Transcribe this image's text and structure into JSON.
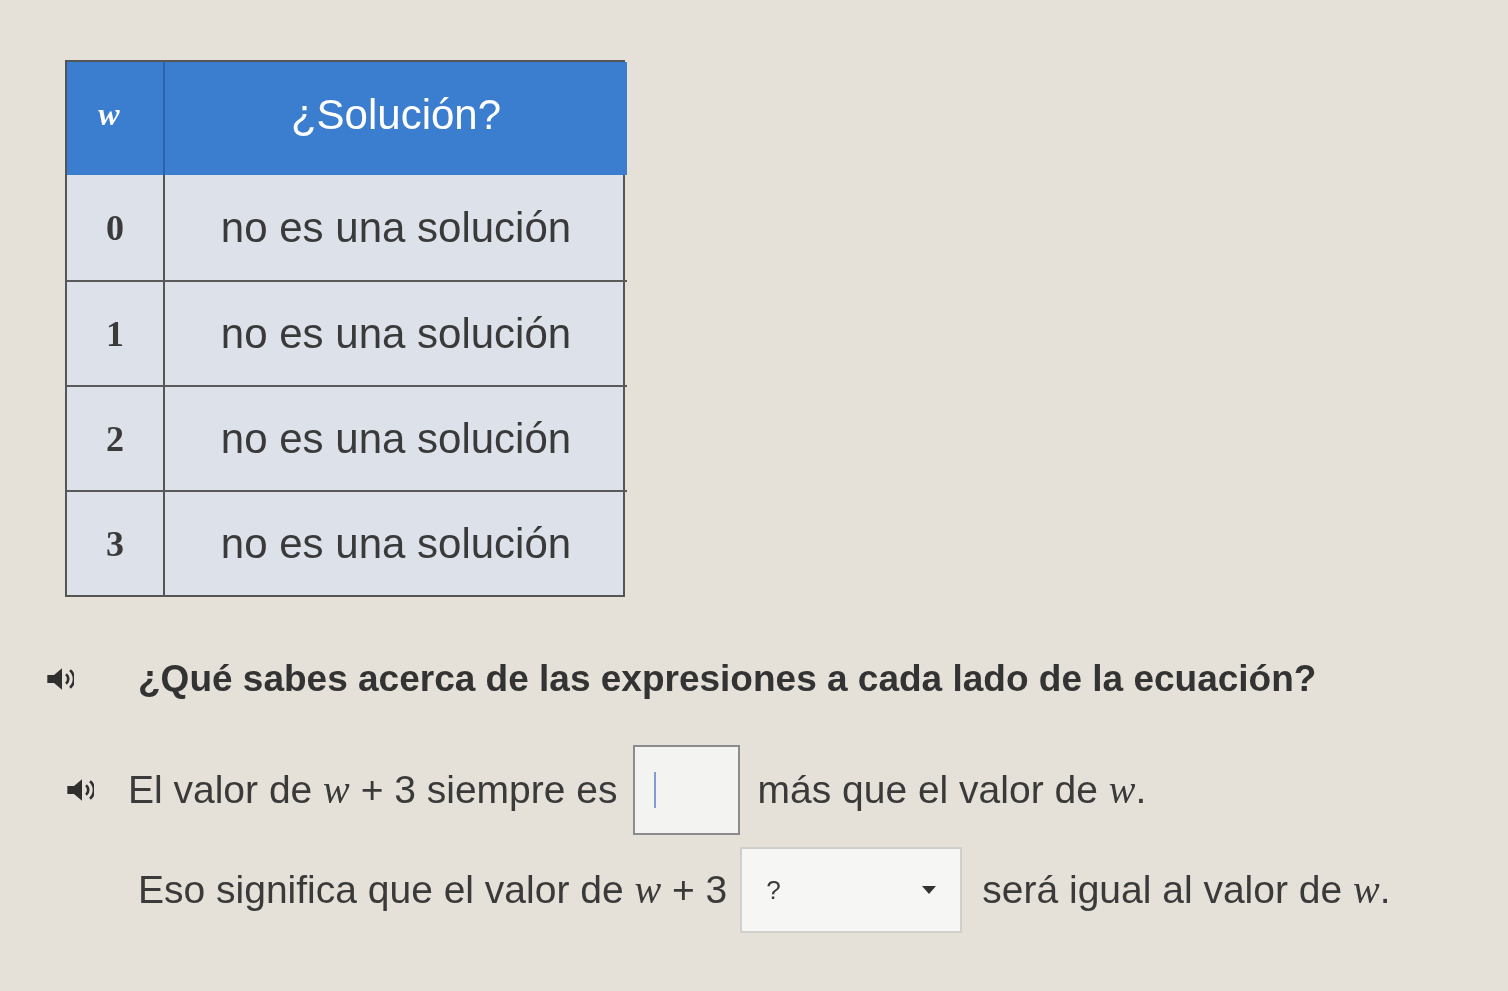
{
  "table": {
    "columns": [
      "w",
      "¿Solución?"
    ],
    "rows": [
      [
        "0",
        "no es una solución"
      ],
      [
        "1",
        "no es una solución"
      ],
      [
        "2",
        "no es una solución"
      ],
      [
        "3",
        "no es una solución"
      ]
    ]
  },
  "question": {
    "audio": true,
    "text": "¿Qué sabes acerca de las expresiones a cada lado de la ecuación?"
  },
  "sentences": [
    {
      "kind": "input",
      "audio": true,
      "before": "El valor de *w* + 3 siempre es",
      "field": {
        "focused": true
      },
      "after": "más que el valor de *w*."
    },
    {
      "kind": "dropdown",
      "audio": false,
      "before": "Eso significa que el valor de *w* + 3",
      "dropdown": {
        "value": "?"
      },
      "after": "será igual al valor de *w*."
    }
  ]
}
